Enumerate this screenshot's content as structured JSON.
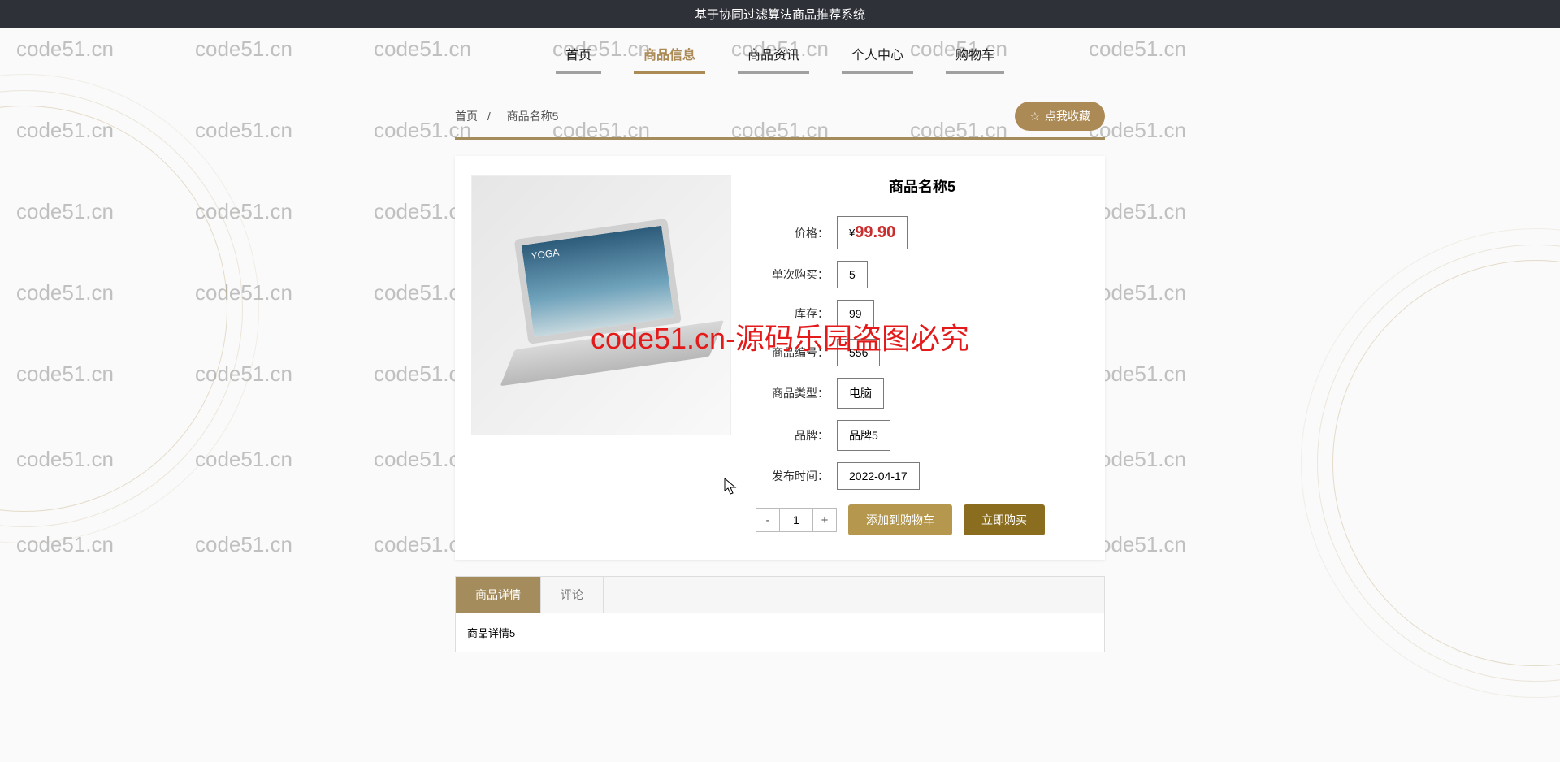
{
  "system_title": "基于协同过滤算法商品推荐系统",
  "nav": [
    "首页",
    "商品信息",
    "商品资讯",
    "个人中心",
    "购物车"
  ],
  "nav_active_index": 1,
  "crumbs": {
    "home": "首页",
    "sep": "/",
    "current": "商品名称5"
  },
  "favorite_label": "点我收藏",
  "product": {
    "name": "商品名称5",
    "fields": [
      {
        "label": "价格：",
        "value": "99.90",
        "is_price": true
      },
      {
        "label": "单次购买：",
        "value": "5"
      },
      {
        "label": "库存：",
        "value": "99"
      },
      {
        "label": "商品编号：",
        "value": "556"
      },
      {
        "label": "商品类型：",
        "value": "电脑"
      },
      {
        "label": "品牌：",
        "value": "品牌5"
      },
      {
        "label": "发布时间：",
        "value": "2022-04-17"
      }
    ],
    "qty": "1",
    "add_cart": "添加到购物车",
    "buy_now": "立即购买"
  },
  "tabs": [
    "商品详情",
    "评论"
  ],
  "tabs_active_index": 0,
  "detail_text": "商品详情5",
  "watermark_text": "code51.cn",
  "red_mark": "code51.cn-源码乐园盗图必究"
}
